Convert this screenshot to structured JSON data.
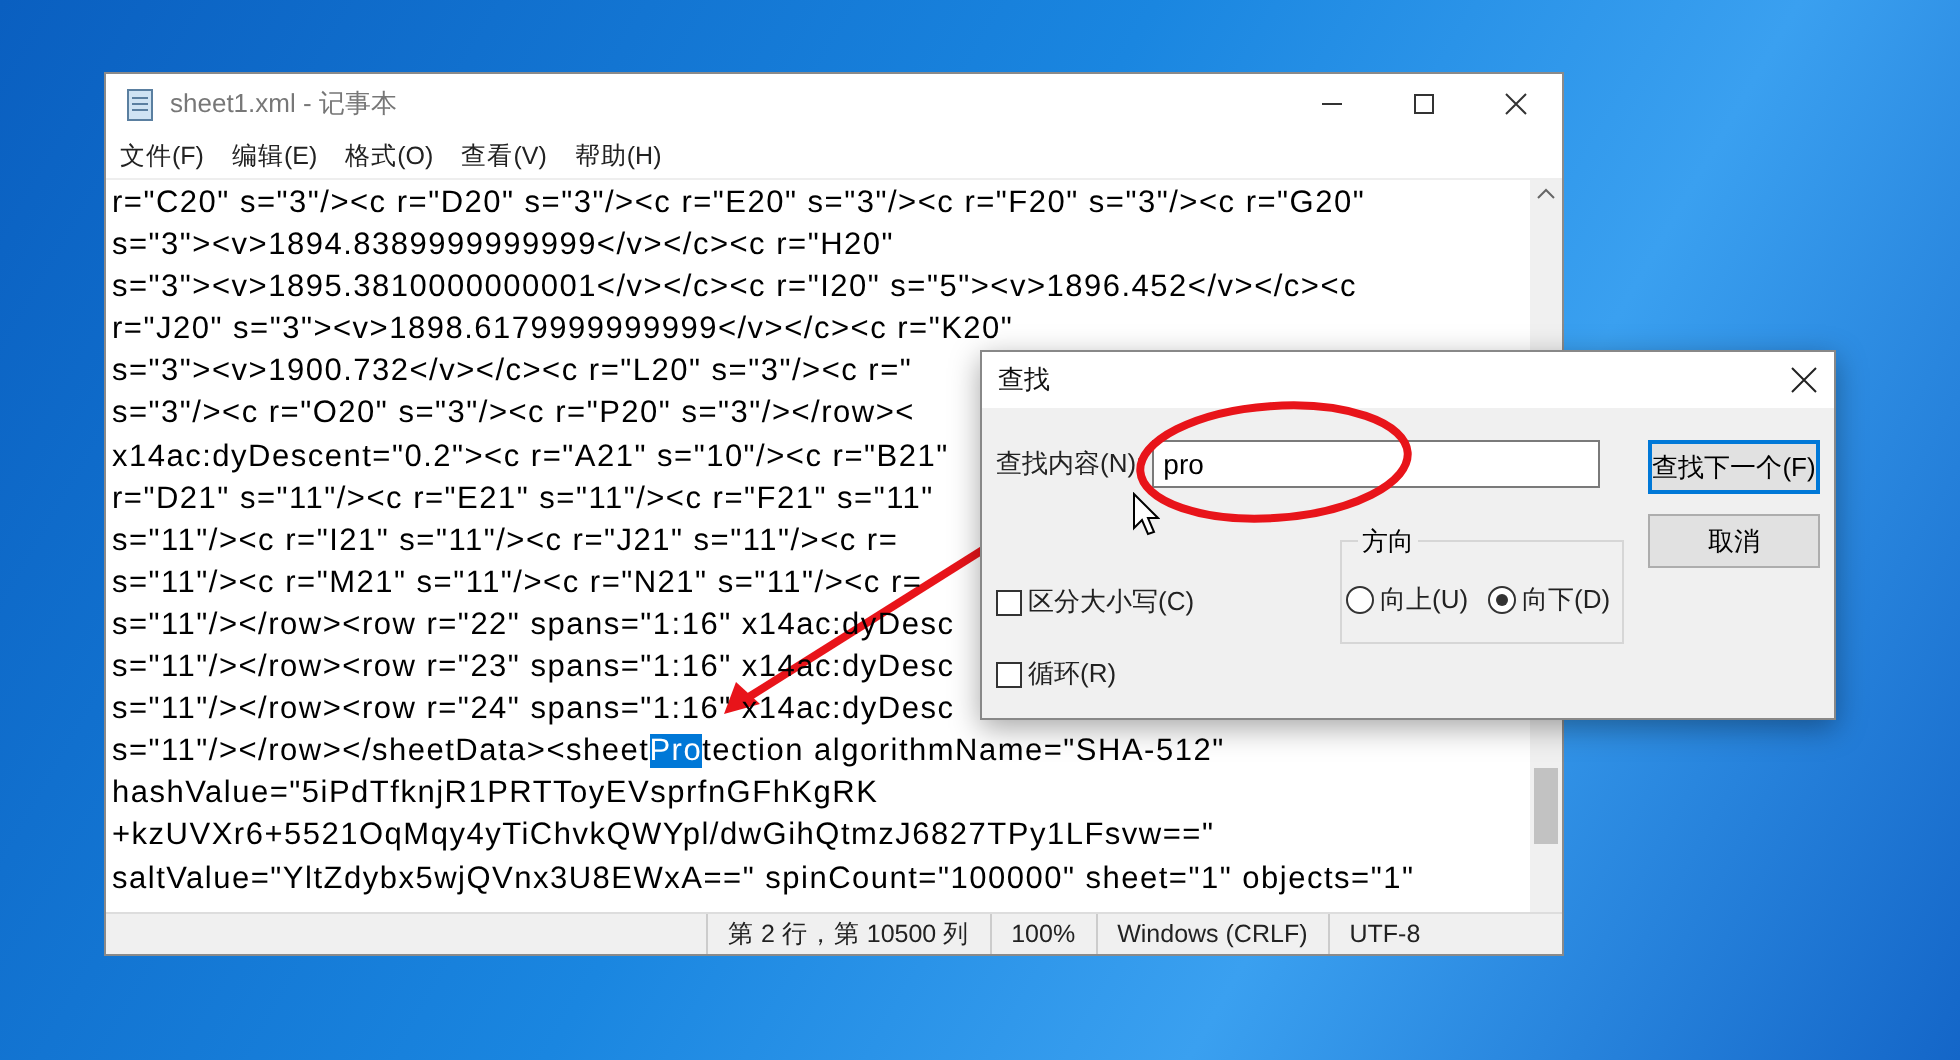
{
  "window": {
    "title": "sheet1.xml - 记事本"
  },
  "menu": [
    "文件(F)",
    "编辑(E)",
    "格式(O)",
    "查看(V)",
    "帮助(H)"
  ],
  "editor_lines": [
    {
      "parts": [
        {
          "text": "r=\"C20\" s=\"3\"/><c r=\"D20\" s=\"3\"/><c r=\"E20\" s=\"3\"/><c r=\"F20\" s=\"3\"/><c r=\"G20\"",
          "selected": false
        }
      ]
    },
    {
      "parts": [
        {
          "text": "s=\"3\"><v>1894.8389999999999</v></c><c r=\"H20\"",
          "selected": false
        }
      ]
    },
    {
      "parts": [
        {
          "text": "s=\"3\"><v>1895.3810000000001</v></c><c r=\"I20\" s=\"5\"><v>1896.452</v></c><c",
          "selected": false
        }
      ]
    },
    {
      "parts": [
        {
          "text": "r=\"J20\" s=\"3\"><v>1898.6179999999999</v></c><c r=\"K20\"",
          "selected": false
        }
      ]
    },
    {
      "parts": [
        {
          "text": "s=\"3\"><v>1900.732</v></c><c r=\"L20\" s=\"3\"/><c r=\"",
          "selected": false
        }
      ]
    },
    {
      "parts": [
        {
          "text": "s=\"3\"/><c r=\"O20\" s=\"3\"/><c r=\"P20\" s=\"3\"/></row><",
          "selected": false
        }
      ]
    },
    {
      "parts": [
        {
          "text": "x14ac:dyDescent=\"0.2\"><c r=\"A21\" s=\"10\"/><c r=\"B21\"",
          "selected": false
        }
      ]
    },
    {
      "parts": [
        {
          "text": "r=\"D21\" s=\"11\"/><c r=\"E21\" s=\"11\"/><c r=\"F21\" s=\"11\"",
          "selected": false
        }
      ]
    },
    {
      "parts": [
        {
          "text": "s=\"11\"/><c r=\"I21\" s=\"11\"/><c r=\"J21\" s=\"11\"/><c r=",
          "selected": false
        }
      ]
    },
    {
      "parts": [
        {
          "text": "s=\"11\"/><c r=\"M21\" s=\"11\"/><c r=\"N21\" s=\"11\"/><c r=",
          "selected": false
        }
      ]
    },
    {
      "parts": [
        {
          "text": "s=\"11\"/></row><row r=\"22\" spans=\"1:16\" x14ac:dyDesc",
          "selected": false
        }
      ]
    },
    {
      "parts": [
        {
          "text": "s=\"11\"/></row><row r=\"23\" spans=\"1:16\" x14ac:dyDesc",
          "selected": false
        }
      ]
    },
    {
      "parts": [
        {
          "text": "s=\"11\"/></row><row r=\"24\" spans=\"1:16\" x14ac:dyDesc",
          "selected": false
        }
      ]
    },
    {
      "parts": [
        {
          "text": "s=\"11\"/></row></sheetData><sheet",
          "selected": false
        },
        {
          "text": "Pro",
          "selected": true
        },
        {
          "text": "tection algorithmName=\"SHA-512\"",
          "selected": false
        }
      ]
    },
    {
      "parts": [
        {
          "text": "hashValue=\"5iPdTfknjR1PRTToyEVsprfnGFhKgRK",
          "selected": false
        }
      ]
    },
    {
      "parts": [
        {
          "text": "+kzUVXr6+5521OqMqy4yTiChvkQWYpl/dwGihQtmzJ6827TPy1LFsvw==\"",
          "selected": false
        }
      ]
    },
    {
      "parts": [
        {
          "text": "saltValue=\"YltZdybx5wjQVnx3U8EWxA==\" spinCount=\"100000\" sheet=\"1\" objects=\"1\"",
          "selected": false
        }
      ]
    }
  ],
  "status_bar": [
    "第 2 行，第 10500 列",
    "100%",
    "Windows (CRLF)",
    "UTF-8"
  ],
  "find_dialog": {
    "title": "查找",
    "label": "查找内容(N):",
    "value": "pro",
    "buttons": [
      {
        "label": "查找下一个(F)",
        "focused": true
      },
      {
        "label": "取消",
        "focused": false
      }
    ],
    "options": [
      {
        "label": "区分大小写(C)",
        "checked": false
      },
      {
        "label": "循环(R)",
        "checked": false
      }
    ],
    "direction": {
      "title": "方向",
      "options": [
        {
          "label": "向上(U)",
          "selected": false
        },
        {
          "label": "向下(D)",
          "selected": true
        }
      ]
    }
  }
}
